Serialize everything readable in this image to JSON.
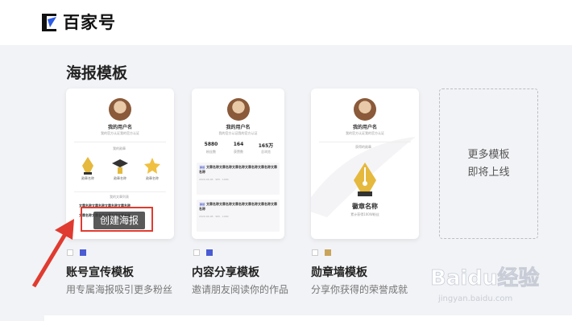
{
  "brand": {
    "logo_text": "百家号"
  },
  "section": {
    "title": "海报模板"
  },
  "card1": {
    "username": "我的用户名",
    "desc": "我的官方认证我的官方认证",
    "medal_header": "我的勋章",
    "medals": [
      "勋章名称",
      "勋章名称",
      "勋章名称"
    ],
    "list_header": "我的文章列表",
    "list_lines": [
      "文章名称文章名称文章名称文章名称",
      "文章名称文章名称文章名称文章名称"
    ]
  },
  "card2": {
    "username": "我的用户名",
    "desc": "我的官方认证我的官方认证",
    "stats": [
      {
        "num": "5880",
        "label": "粉丝数"
      },
      {
        "num": "164",
        "label": "获赞数"
      },
      {
        "num": "165万",
        "label": "总浏览"
      }
    ],
    "articles": [
      {
        "tag": "原创",
        "text": "文章名称文章名称文章名称文章名称文章名称文章名称",
        "date": "2020-04-06",
        "views": "965",
        "likes": "1090"
      },
      {
        "tag": "原创",
        "text": "文章名称文章名称文章名称文章名称文章名称文章名称",
        "date": "2020-04-06",
        "views": "965",
        "likes": "1090"
      }
    ]
  },
  "card3": {
    "username": "我的用户名",
    "desc": "我的官方认证我的官方认证",
    "medal_header": "获得的勋章",
    "medal_name": "徽章名称",
    "medal_sub": "累计获得100W粉丝"
  },
  "more": {
    "line1": "更多模板",
    "line2": "即将上线"
  },
  "create_button": "创建海报",
  "templates": [
    {
      "name": "账号宣传模板",
      "desc": "用专属海报吸引更多粉丝",
      "swatches": [
        "#ffffff",
        "#4a5bd4"
      ]
    },
    {
      "name": "内容分享模板",
      "desc": "邀请朋友阅读你的作品",
      "swatches": [
        "#ffffff",
        "#4a5bd4"
      ]
    },
    {
      "name": "勋章墙模板",
      "desc": "分享你获得的荣誉成就",
      "swatches": [
        "#ffffff",
        "#c9a45a"
      ]
    }
  ],
  "watermark": {
    "text": "Baidu经验",
    "url": "jingyan.baidu.com"
  }
}
